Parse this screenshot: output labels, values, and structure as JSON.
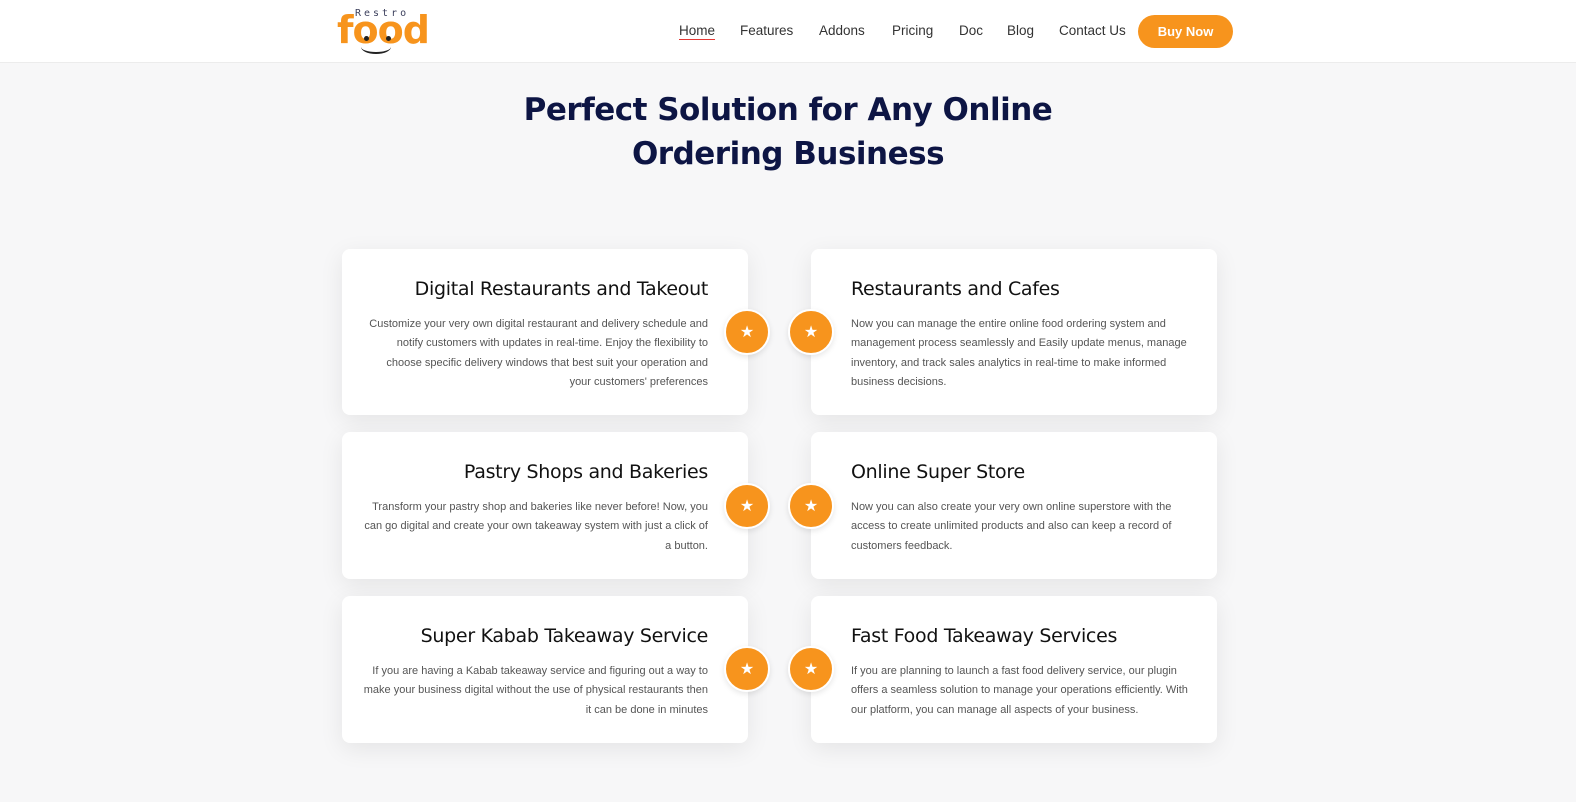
{
  "header": {
    "logo": {
      "top_text": "Restro",
      "main_text": "food"
    },
    "nav": [
      {
        "label": "Home",
        "active": true
      },
      {
        "label": "Features",
        "active": false
      },
      {
        "label": "Addons",
        "active": false
      },
      {
        "label": "Pricing",
        "active": false
      },
      {
        "label": "Doc",
        "active": false
      },
      {
        "label": "Blog",
        "active": false
      },
      {
        "label": "Contact Us",
        "active": false
      }
    ],
    "cta_label": "Buy Now"
  },
  "section": {
    "title_line1": "Perfect Solution for Any Online",
    "title_line2": "Ordering Business"
  },
  "cards": [
    {
      "title": "Digital Restaurants and Takeout",
      "text": "Customize your very own digital restaurant and delivery schedule and notify customers with updates in real-time. Enjoy the flexibility to choose specific delivery windows that best suit your operation and your customers' preferences",
      "icon": "star-icon"
    },
    {
      "title": "Restaurants and Cafes",
      "text": "Now you can manage the entire online food ordering system and management process seamlessly and Easily update menus, manage inventory, and track sales analytics in real-time to make informed business decisions.",
      "icon": "star-icon"
    },
    {
      "title": "Pastry Shops and Bakeries",
      "text": "Transform your pastry shop and bakeries like never before! Now, you can go digital and create your own takeaway system with just a click of a button.",
      "icon": "star-icon"
    },
    {
      "title": "Online Super Store",
      "text": "Now you can also create your very own online superstore with the access to create unlimited products and also can keep a record of customers feedback.",
      "icon": "star-icon"
    },
    {
      "title": "Super Kabab Takeaway Service",
      "text": "If you are having a Kabab takeaway service and figuring out a way to make your business digital without the use of physical restaurants then it can be done in minutes",
      "icon": "star-icon"
    },
    {
      "title": "Fast Food Takeaway Services",
      "text": "If you are planning to launch a fast food delivery service, our plugin offers a seamless solution to manage your operations efficiently. With our platform, you can manage all aspects of your business.",
      "icon": "star-icon"
    }
  ],
  "colors": {
    "accent": "#f7941d",
    "heading": "#0d1544",
    "background": "#f7f7f8"
  }
}
